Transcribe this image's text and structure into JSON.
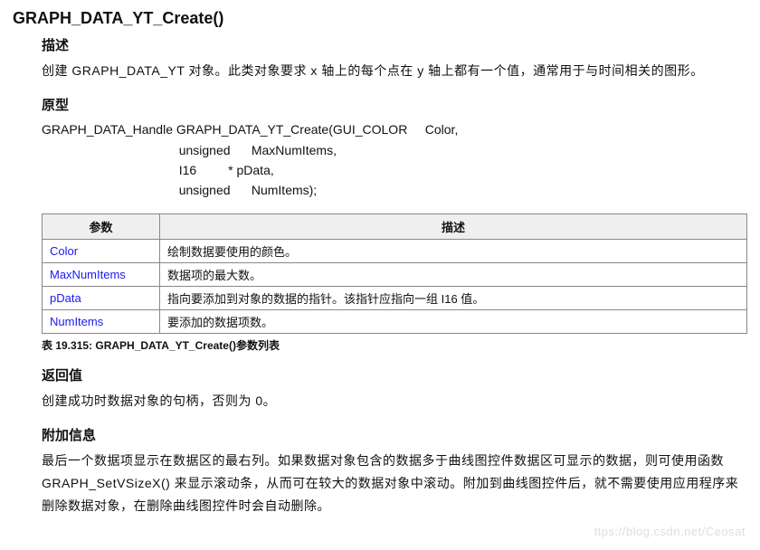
{
  "title": "GRAPH_DATA_YT_Create()",
  "sections": {
    "desc": {
      "heading": "描述",
      "text": "创建 GRAPH_DATA_YT 对象。此类对象要求 x 轴上的每个点在 y 轴上都有一个值，通常用于与时间相关的图形。"
    },
    "proto": {
      "heading": "原型",
      "code": "GRAPH_DATA_Handle GRAPH_DATA_YT_Create(GUI_COLOR     Color,\n                                       unsigned      MaxNumItems,\n                                       I16         * pData,\n                                       unsigned      NumItems);"
    },
    "params": {
      "header_param": "参数",
      "header_desc": "描述",
      "rows": [
        {
          "name": "Color",
          "desc": "绘制数据要使用的颜色。"
        },
        {
          "name": "MaxNumItems",
          "desc": "数据项的最大数。"
        },
        {
          "name": "pData",
          "desc": "指向要添加到对象的数据的指针。该指针应指向一组 I16 值。"
        },
        {
          "name": "NumItems",
          "desc": "要添加的数据项数。"
        }
      ],
      "caption": "表 19.315: GRAPH_DATA_YT_Create()参数列表"
    },
    "return": {
      "heading": "返回值",
      "text": "创建成功时数据对象的句柄，否则为 0。"
    },
    "additional": {
      "heading": "附加信息",
      "text": "最后一个数据项显示在数据区的最右列。如果数据对象包含的数据多于曲线图控件数据区可显示的数据，则可使用函数 GRAPH_SetVSizeX() 来显示滚动条，从而可在较大的数据对象中滚动。附加到曲线图控件后，就不需要使用应用程序来删除数据对象，在删除曲线图控件时会自动删除。"
    }
  },
  "watermark": "ttps://blog.csdn.net/Ceosat"
}
